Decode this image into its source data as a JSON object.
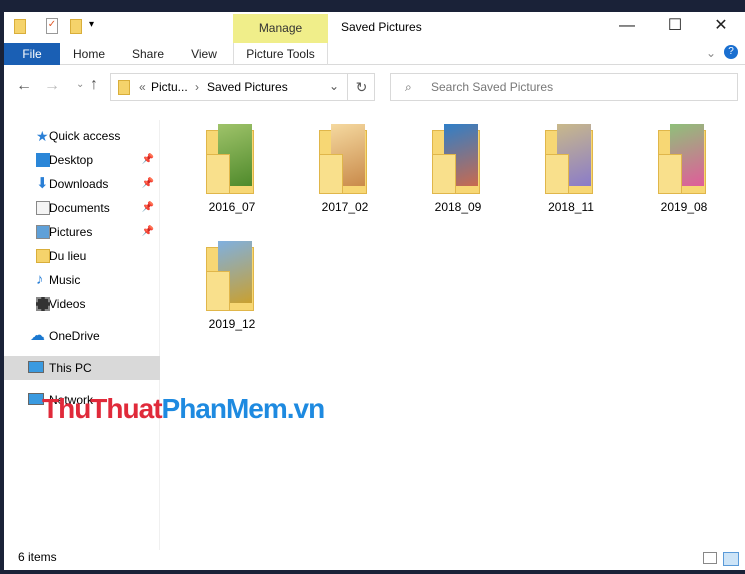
{
  "window": {
    "title": "Saved Pictures",
    "manage": "Manage"
  },
  "ribbon": {
    "tabs": [
      "File",
      "Home",
      "Share",
      "View",
      "Picture Tools"
    ]
  },
  "address": {
    "crumbs": [
      "Pictu...",
      "Saved Pictures"
    ],
    "overflow": "«"
  },
  "search": {
    "placeholder": "Search Saved Pictures"
  },
  "sidebar": {
    "items": [
      {
        "label": "Quick access",
        "pinned": false
      },
      {
        "label": "Desktop",
        "pinned": true
      },
      {
        "label": "Downloads",
        "pinned": true
      },
      {
        "label": "Documents",
        "pinned": true
      },
      {
        "label": "Pictures",
        "pinned": true
      },
      {
        "label": "Du lieu",
        "pinned": false
      },
      {
        "label": "Music",
        "pinned": false
      },
      {
        "label": "Videos",
        "pinned": false
      },
      {
        "label": "OneDrive",
        "pinned": false
      },
      {
        "label": "This PC",
        "pinned": false
      },
      {
        "label": "Network",
        "pinned": false
      }
    ]
  },
  "folders": [
    {
      "name": "2016_07",
      "colors": [
        "#9fc36a",
        "#4f8a2b"
      ]
    },
    {
      "name": "2017_02",
      "colors": [
        "#f5d9a0",
        "#c98a4a"
      ]
    },
    {
      "name": "2018_09",
      "colors": [
        "#2f7fc8",
        "#c96a4f"
      ]
    },
    {
      "name": "2018_11",
      "colors": [
        "#c9b98a",
        "#8a7bc9"
      ]
    },
    {
      "name": "2019_08",
      "colors": [
        "#8fc07a",
        "#e05c9a"
      ]
    },
    {
      "name": "2019_12",
      "colors": [
        "#7fb0e0",
        "#c9a030"
      ]
    }
  ],
  "status": {
    "count": "6 items"
  },
  "watermark": {
    "red": "ThuThuat",
    "blue": "PhanMem.vn"
  }
}
